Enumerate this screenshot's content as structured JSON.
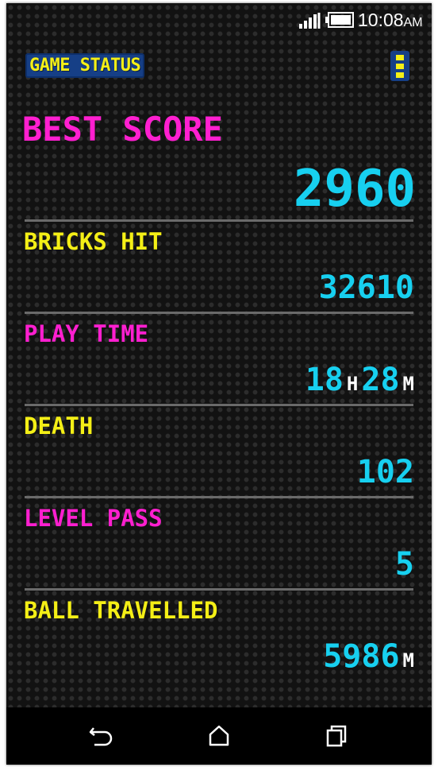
{
  "status_bar": {
    "time": "10:08",
    "ampm": "AM",
    "icons": [
      "signal-icon",
      "battery-icon"
    ]
  },
  "header": {
    "title": "GAME STATUS",
    "menu_icon": "overflow-menu-icon"
  },
  "best_score": {
    "label": "BEST SCORE",
    "value": "2960"
  },
  "stats": {
    "bricks_hit": {
      "label": "BRICKS HIT",
      "value": "32610"
    },
    "play_time": {
      "label": "PLAY TIME",
      "hours": "18",
      "hours_unit": "H",
      "minutes": "28",
      "minutes_unit": "M"
    },
    "death": {
      "label": "DEATH",
      "value": "102"
    },
    "level_pass": {
      "label": "LEVEL PASS",
      "value": "5"
    },
    "ball_travelled": {
      "label": "BALL TRAVELLED",
      "value": "5986",
      "unit": "M"
    }
  },
  "nav_bar": {
    "buttons": [
      "back-icon",
      "home-icon",
      "recents-icon"
    ]
  },
  "colors": {
    "yellow": "#f4ef16",
    "pink": "#ff1fd0",
    "cyan": "#17d0f0",
    "title_bg": "#163f86",
    "background": "#121212"
  }
}
